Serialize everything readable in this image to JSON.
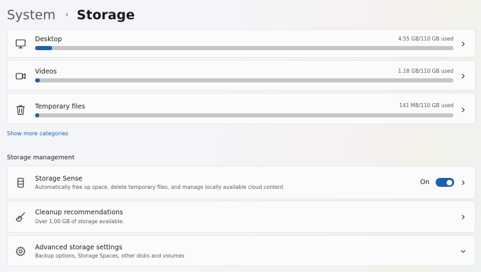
{
  "breadcrumb": {
    "parent": "System",
    "separator": "›",
    "current": "Storage"
  },
  "categories": [
    {
      "label": "Desktop",
      "used": "4.55 GB/110 GB used",
      "fraction": 0.041,
      "icon": "monitor-icon"
    },
    {
      "label": "Videos",
      "used": "1.18 GB/110 GB used",
      "fraction": 0.011,
      "icon": "video-camera-icon"
    },
    {
      "label": "Temporary files",
      "used": "141 MB/110 GB used",
      "fraction": 0.0013,
      "icon": "trash-icon"
    }
  ],
  "show_more_label": "Show more categories",
  "management": {
    "heading": "Storage management",
    "storage_sense": {
      "title": "Storage Sense",
      "description": "Automatically free up space, delete temporary files, and manage locally available cloud content",
      "toggle_label": "On",
      "toggle_on": true,
      "icon": "drive-icon"
    },
    "cleanup": {
      "title": "Cleanup recommendations",
      "description": "Over 1.00 GB of storage available.",
      "icon": "broom-icon"
    },
    "advanced": {
      "title": "Advanced storage settings",
      "description": "Backup options, Storage Spaces, other disks and volumes",
      "icon": "gear-icon"
    }
  },
  "colors": {
    "accent": "#1f5fb0",
    "link": "#1e5da7",
    "bar_track": "#c6c6c6"
  }
}
